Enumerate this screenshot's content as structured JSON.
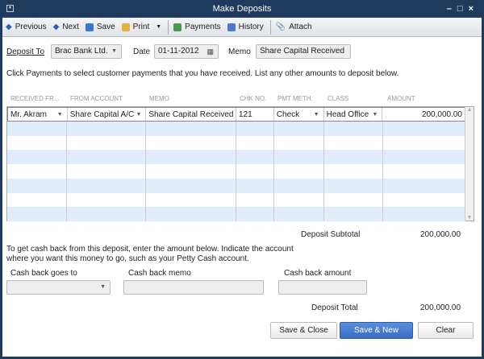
{
  "window": {
    "title": "Make Deposits"
  },
  "toolbar": {
    "previous": "Previous",
    "next": "Next",
    "save": "Save",
    "print": "Print",
    "payments": "Payments",
    "history": "History",
    "attach": "Attach"
  },
  "header": {
    "deposit_to_label": "Deposit To",
    "deposit_to_value": "Brac Bank Ltd.",
    "date_label": "Date",
    "date_value": "01-11-2012",
    "memo_label": "Memo",
    "memo_value": "Share Capital Received"
  },
  "instructions": "Click Payments to select customer payments that you have received. List any other amounts to deposit below.",
  "table": {
    "columns": [
      "RECEIVED FR...",
      "FROM ACCOUNT",
      "MEMO",
      "CHK NO.",
      "PMT METH.",
      "CLASS",
      "AMOUNT"
    ],
    "rows": [
      [
        "Mr. Akram",
        "Share Capital A/C",
        "Share Capital Received",
        "121",
        "Check",
        "Head Office",
        "200,000.00"
      ]
    ]
  },
  "subtotal": {
    "label": "Deposit Subtotal",
    "value": "200,000.00"
  },
  "cashback": {
    "text1": "To get cash back from this deposit, enter the amount below.  Indicate the account",
    "text2": "where you want this money to go, such as your Petty Cash account.",
    "goes_to_label": "Cash back goes to",
    "memo_label": "Cash back memo",
    "amount_label": "Cash back amount"
  },
  "total": {
    "label": "Deposit Total",
    "value": "200,000.00"
  },
  "buttons": {
    "save_close": "Save & Close",
    "save_new": "Save & New",
    "clear": "Clear"
  },
  "colors": {
    "frame": "#1f3a5c",
    "accent": "#3f74c9",
    "row_alt": "#e1ecfb"
  }
}
